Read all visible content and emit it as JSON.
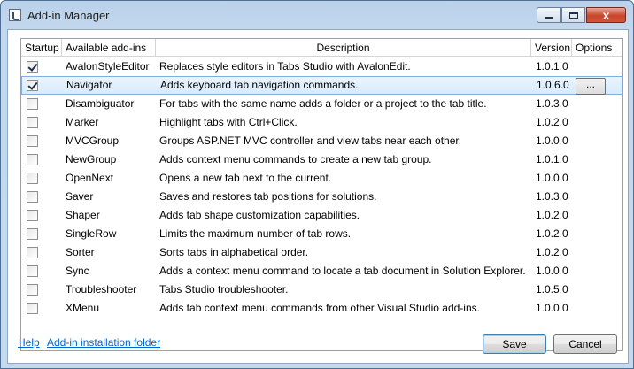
{
  "window": {
    "title": "Add-in Manager",
    "close_glyph": "x",
    "icon": "app-music-note-icon"
  },
  "columns": {
    "startup": "Startup",
    "name": "Available add-ins",
    "description": "Description",
    "version": "Version",
    "options": "Options"
  },
  "rows": [
    {
      "checked": true,
      "name": "AvalonStyleEditor",
      "description": "Replaces style editors in Tabs Studio with AvalonEdit.",
      "version": "1.0.1.0"
    },
    {
      "checked": true,
      "name": "Navigator",
      "description": "Adds keyboard tab navigation commands.",
      "version": "1.0.6.0",
      "options_label": "...",
      "selected": true
    },
    {
      "checked": false,
      "name": "Disambiguator",
      "description": "For tabs with the same name adds a folder or a project to the tab title.",
      "version": "1.0.3.0"
    },
    {
      "checked": false,
      "name": "Marker",
      "description": "Highlight tabs with Ctrl+Click.",
      "version": "1.0.2.0"
    },
    {
      "checked": false,
      "name": "MVCGroup",
      "description": "Groups ASP.NET MVC controller and view tabs near each other.",
      "version": "1.0.0.0"
    },
    {
      "checked": false,
      "name": "NewGroup",
      "description": "Adds context menu commands to create a new tab group.",
      "version": "1.0.1.0"
    },
    {
      "checked": false,
      "name": "OpenNext",
      "description": "Opens a new tab next to the current.",
      "version": "1.0.0.0"
    },
    {
      "checked": false,
      "name": "Saver",
      "description": "Saves and restores tab positions for solutions.",
      "version": "1.0.3.0"
    },
    {
      "checked": false,
      "name": "Shaper",
      "description": "Adds tab shape customization capabilities.",
      "version": "1.0.2.0"
    },
    {
      "checked": false,
      "name": "SingleRow",
      "description": "Limits the maximum number of tab rows.",
      "version": "1.0.2.0"
    },
    {
      "checked": false,
      "name": "Sorter",
      "description": "Sorts tabs in alphabetical order.",
      "version": "1.0.2.0"
    },
    {
      "checked": false,
      "name": "Sync",
      "description": "Adds a context menu command to locate a tab document in Solution Explorer.",
      "version": "1.0.0.0"
    },
    {
      "checked": false,
      "name": "Troubleshooter",
      "description": "Tabs Studio troubleshooter.",
      "version": "1.0.5.0"
    },
    {
      "checked": false,
      "name": "XMenu",
      "description": "Adds tab context menu commands from other Visual Studio add-ins.",
      "version": "1.0.0.0"
    }
  ],
  "footer": {
    "help_link": "Help",
    "folder_link": "Add-in installation folder",
    "save_label": "Save",
    "cancel_label": "Cancel"
  }
}
